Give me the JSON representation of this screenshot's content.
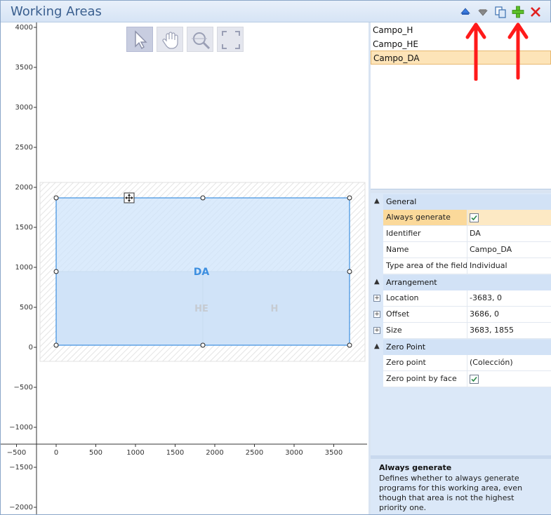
{
  "window": {
    "title": "Working Areas"
  },
  "toolbar": {
    "icons": [
      "move-up-icon",
      "move-down-icon",
      "copy-icon",
      "add-icon",
      "delete-icon"
    ],
    "colors": {
      "up": "#3a7be0",
      "down": "#8a8a8a",
      "add": "#4caf20",
      "delete": "#e02020"
    }
  },
  "canvas": {
    "tools": [
      "select-tool",
      "pan-tool",
      "zoom-tool",
      "fit-tool"
    ],
    "y_ticks": [
      "4000",
      "3500",
      "3000",
      "2500",
      "2000",
      "1500",
      "1000",
      "500",
      "0",
      "−500",
      "−1000",
      "−1500",
      "−2000"
    ],
    "x_ticks": [
      "−500",
      "0",
      "500",
      "1000",
      "1500",
      "2000",
      "2500",
      "3000",
      "3500"
    ],
    "areas": [
      {
        "label": "DA",
        "color": "#3d8fe0"
      },
      {
        "label": "HE",
        "color": "#c6cbd2"
      },
      {
        "label": "H",
        "color": "#c6cbd2"
      }
    ]
  },
  "working_areas_list": {
    "items": [
      {
        "label": "Campo_H"
      },
      {
        "label": "Campo_HE"
      },
      {
        "label": "Campo_DA",
        "selected": true
      }
    ]
  },
  "properties": {
    "general": {
      "label": "General",
      "always_generate": {
        "name": "Always generate",
        "checked": true
      },
      "identifier": {
        "name": "Identifier",
        "value": "DA"
      },
      "name": {
        "name": "Name",
        "value": "Campo_DA"
      },
      "type_area": {
        "name": "Type area of the field...",
        "value": "Individual"
      }
    },
    "arrangement": {
      "label": "Arrangement",
      "location": {
        "name": "Location",
        "value": "-3683, 0"
      },
      "offset": {
        "name": "Offset",
        "value": "3686, 0"
      },
      "size": {
        "name": "Size",
        "value": "3683, 1855"
      }
    },
    "zero_point": {
      "label": "Zero Point",
      "zero_point": {
        "name": "Zero point",
        "value": "(Colección)"
      },
      "zero_point_by_face": {
        "name": "Zero point by face",
        "checked": true
      }
    }
  },
  "description": {
    "title": "Always generate",
    "text": "Defines whether to always generate programs for this working area, even though that area is not the highest priority one."
  },
  "annotations": {
    "arrow_color": "#ff1a1a"
  }
}
